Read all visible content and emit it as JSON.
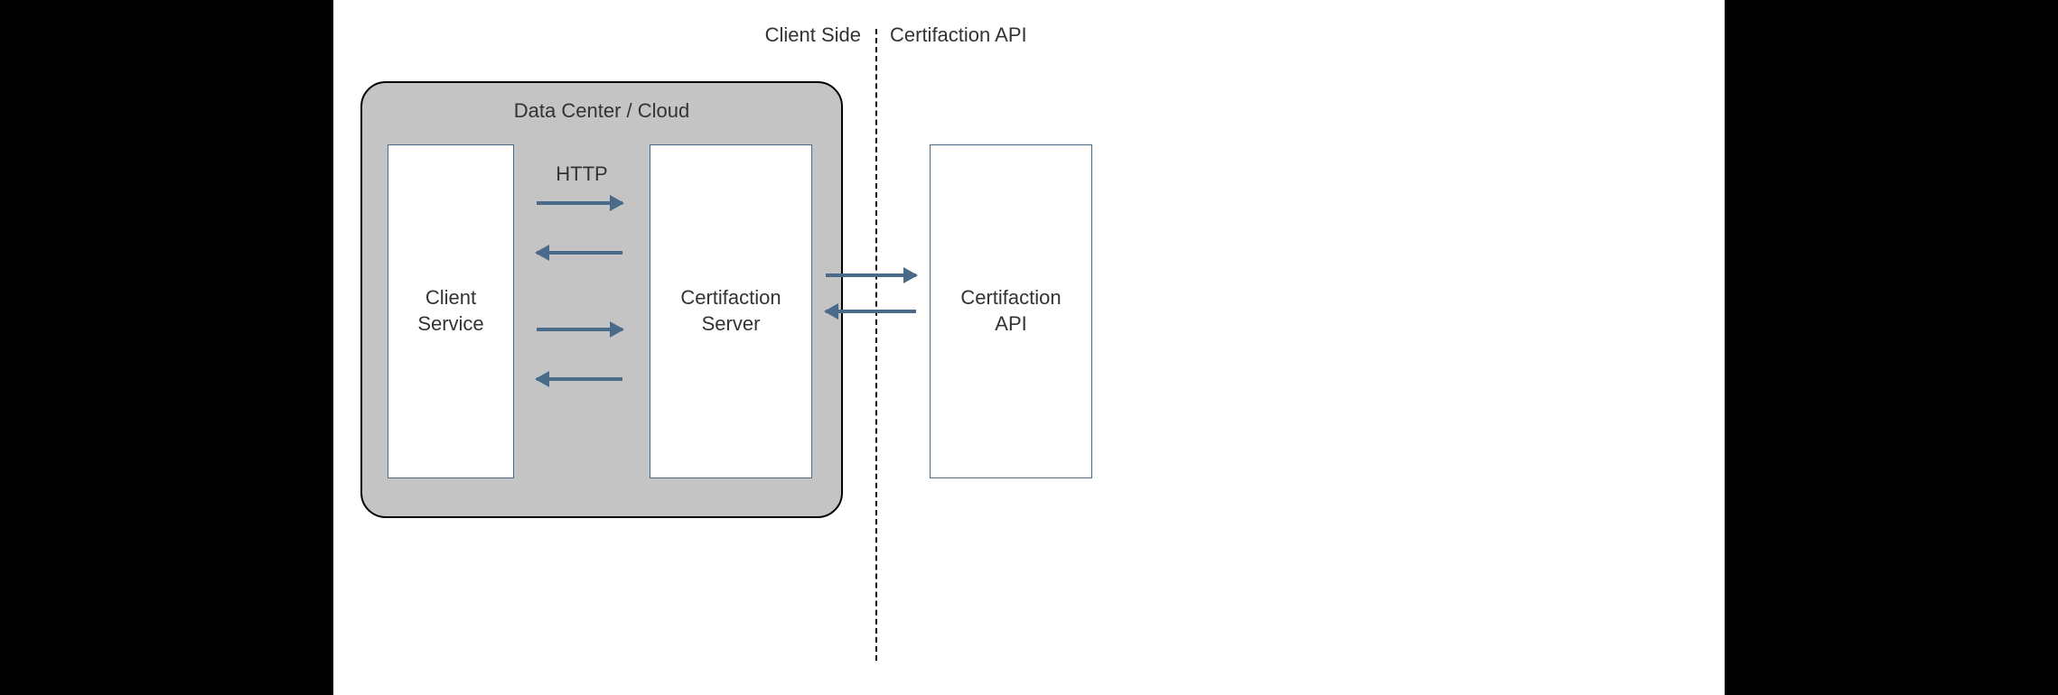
{
  "top_labels": {
    "client_side": "Client Side",
    "certifaction_api": "Certifaction API"
  },
  "data_center": {
    "title": "Data Center / Cloud"
  },
  "nodes": {
    "client_service": "Client\nService",
    "cert_server": "Certifaction\nServer",
    "cert_api": "Certifaction\nAPI"
  },
  "labels": {
    "http": "HTTP"
  }
}
